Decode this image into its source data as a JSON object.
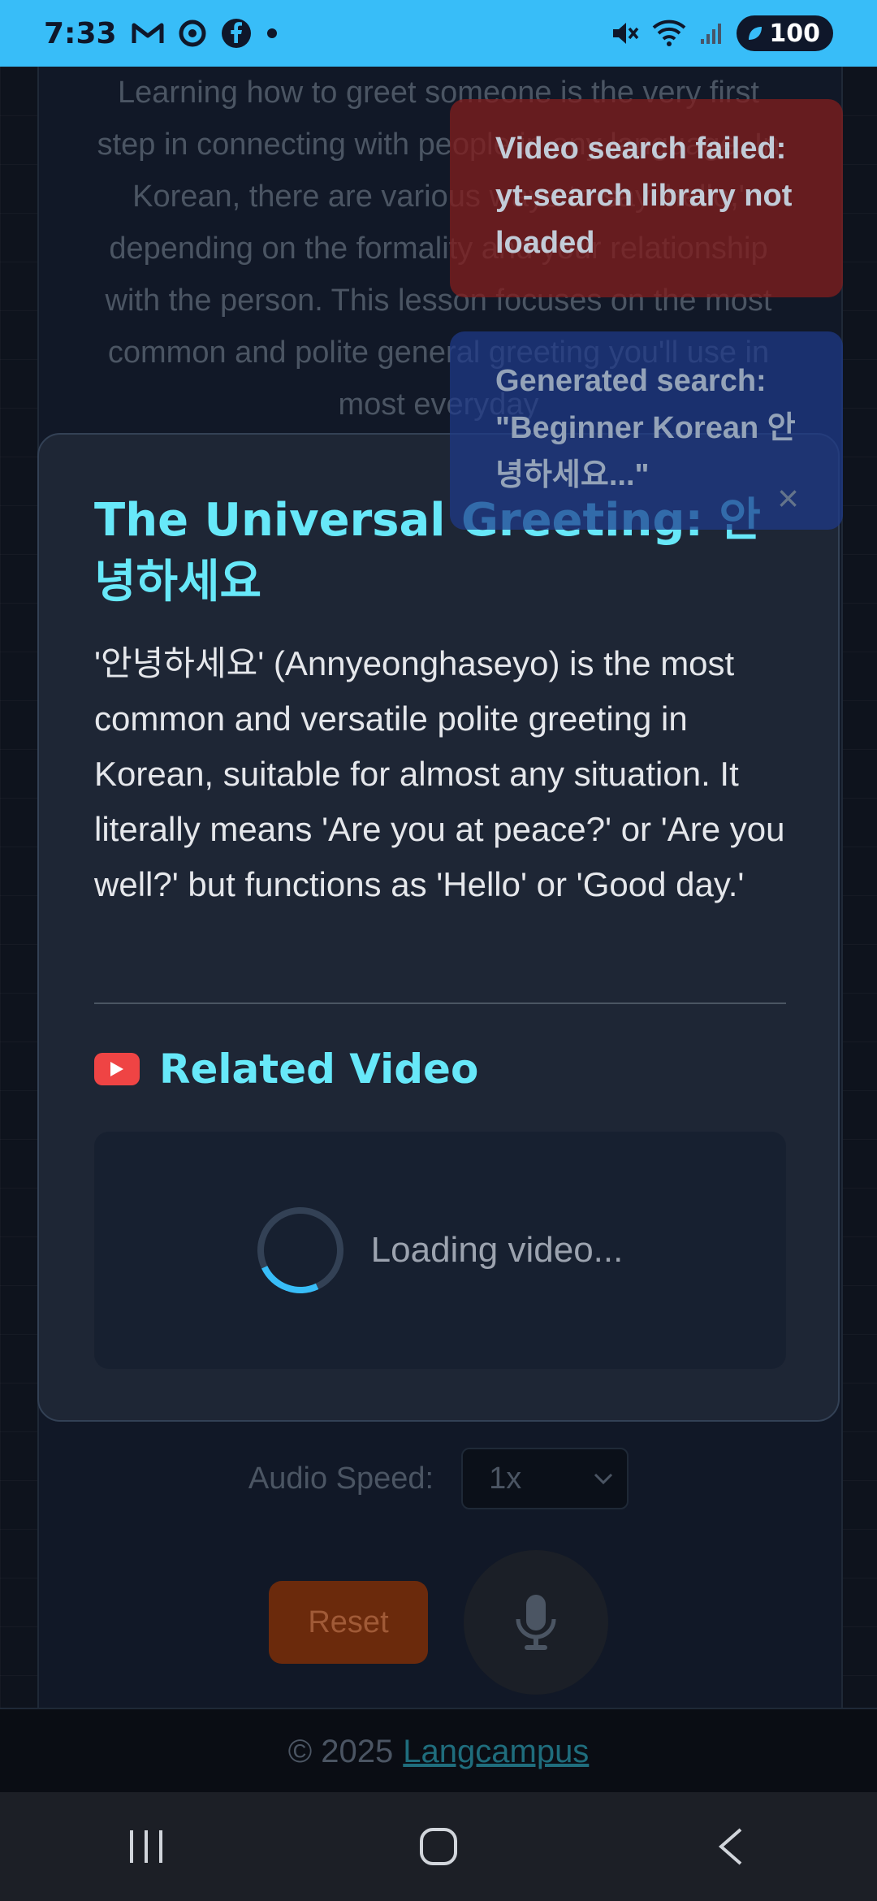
{
  "status_bar": {
    "time": "7:33",
    "left_icons": [
      "gmail-icon",
      "chrome-icon",
      "facebook-icon",
      "dot-icon"
    ],
    "right_icons": [
      "mute-icon",
      "wifi-icon",
      "signal-icon"
    ],
    "battery": "100"
  },
  "lesson": {
    "intro_text": "Learning how to greet someone is the very first step in connecting with people in any language. In Korean, there are various ways to say 'hello,' depending on the formality and your relationship with the person. This lesson focuses on the most common and polite general greeting you'll use in most everyday"
  },
  "modal": {
    "title": "The Universal Greeting: 안녕하세요",
    "body": "'안녕하세요' (Annyeonghaseyo) is the most common and versatile polite greeting in Korean, suitable for almost any situation. It literally means 'Are you at peace?' or 'Are you well?' but functions as 'Hello' or 'Good day.'",
    "video_heading": "Related Video",
    "loading_text": "Loading video..."
  },
  "controls": {
    "audio_speed_label": "Audio Speed:",
    "audio_speed_value": "1x",
    "reset_label": "Reset"
  },
  "footer": {
    "copyright": "© 2025",
    "link": "Langcampus"
  },
  "toasts": {
    "error": "Video search failed: yt-search library not loaded",
    "info": "Generated search: \"Beginner Korean 안녕하세요...\"",
    "close": "×"
  },
  "colors": {
    "accent": "#67e8f9",
    "status_bar": "#38bdf8",
    "youtube_red": "#ef4444",
    "reset_orange": "#6b2a0c"
  }
}
